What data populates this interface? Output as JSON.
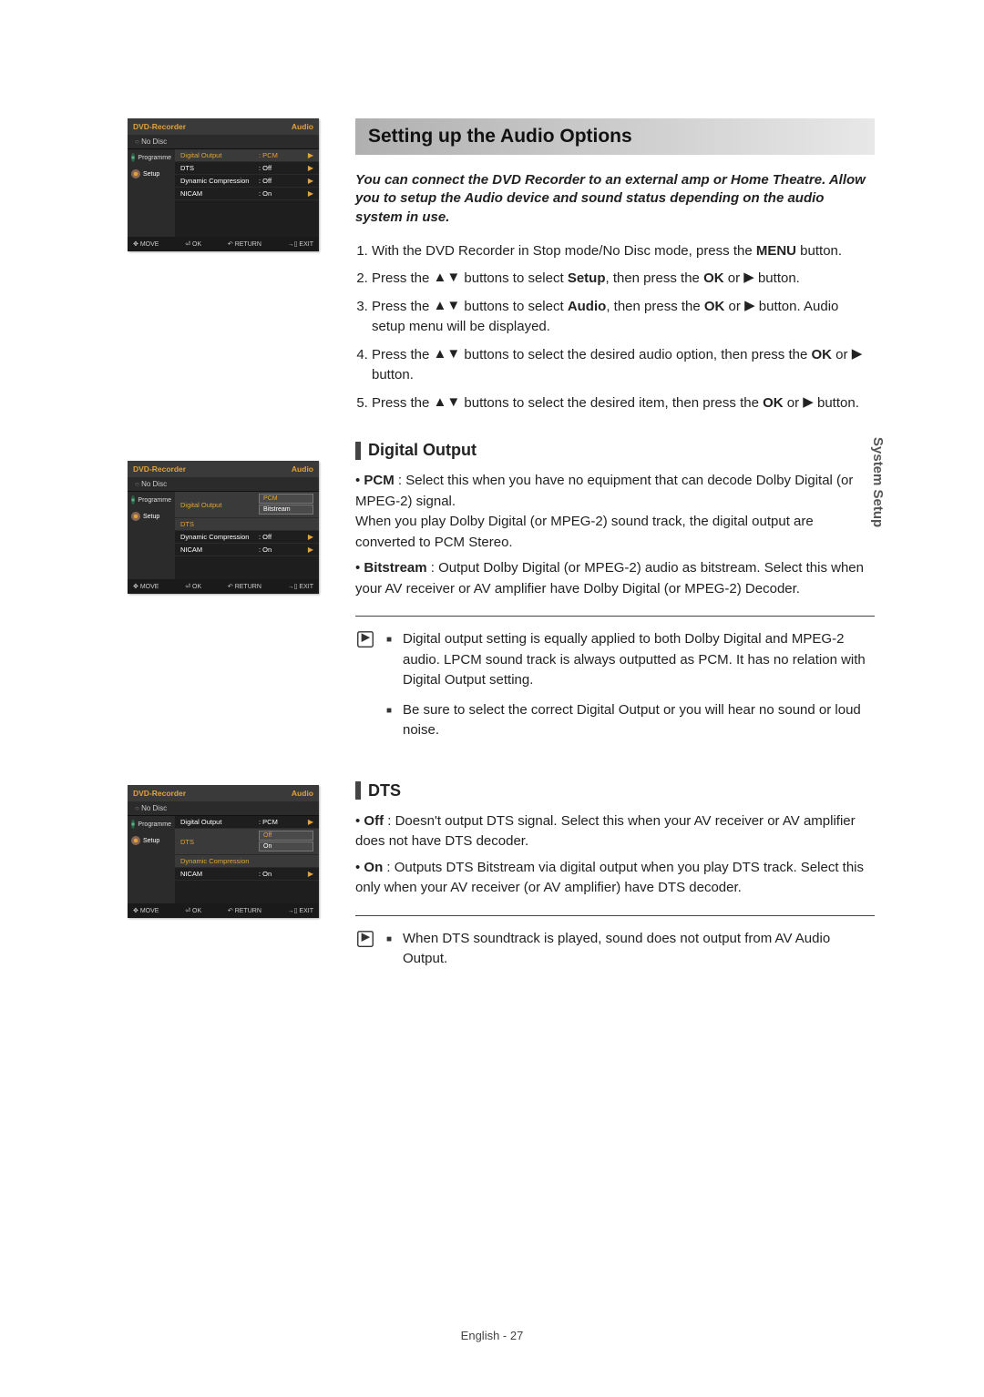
{
  "page": {
    "side_tab": "System Setup",
    "footer": "English - 27"
  },
  "banner": "Setting up the Audio Options",
  "intro": "You can connect the DVD Recorder to an external amp or Home Theatre. Allow you to setup the Audio device and sound status depending on the audio system in use.",
  "steps": {
    "s1": "With the DVD Recorder in Stop mode/No Disc mode, press the MENU button.",
    "s2a": "Press the ",
    "s2b": " buttons to select Setup, then press the OK or ",
    "s2c": " button.",
    "s3a": "Press the ",
    "s3b": " buttons to select Audio, then press the OK or ",
    "s3c": " button. Audio setup menu will be displayed.",
    "s4a": "Press the ",
    "s4b": " buttons to select the desired audio option, then press the OK or ",
    "s4c": " button.",
    "s5a": "Press the ",
    "s5b": " buttons to select the desired item, then press the OK or ",
    "s5c": " button."
  },
  "symbols": {
    "updown": "▲▼",
    "play": "▶"
  },
  "sections": {
    "digital": {
      "title": "Digital Output",
      "pcm_label": "PCM",
      "pcm_text": " : Select this when you have no equipment that can decode Dolby Digital (or MPEG-2) signal.",
      "pcm_text2": "When you play Dolby Digital (or MPEG-2) sound track, the digital output are converted to PCM Stereo.",
      "bit_label": "Bitstream",
      "bit_text": " : Output Dolby Digital (or MPEG-2) audio as bitstream. Select this when your AV receiver or AV amplifier have Dolby Digital (or MPEG-2) Decoder.",
      "note1": "Digital output setting is equally applied to both Dolby Digital and MPEG-2 audio. LPCM sound track is always outputted as PCM. It has no relation with Digital Output setting.",
      "note2": "Be sure to select the correct Digital Output or you will hear no sound or loud noise."
    },
    "dts": {
      "title": "DTS",
      "off_label": "Off",
      "off_text": " : Doesn't output DTS signal. Select this when your AV receiver or AV amplifier does not have DTS decoder.",
      "on_label": "On",
      "on_text": " : Outputs DTS Bitstream via digital output when you play DTS track. Select this only when your AV receiver (or AV amplifier) have DTS decoder.",
      "note1": "When DTS soundtrack is played, sound does not output from AV Audio Output."
    }
  },
  "osd": {
    "title_left": "DVD-Recorder",
    "title_right": "Audio",
    "status": "No Disc",
    "side": {
      "programme": "Programme",
      "setup": "Setup"
    },
    "rows": {
      "digital": {
        "label": "Digital Output",
        "val": ": PCM"
      },
      "dts": {
        "label": "DTS",
        "val": ": Off"
      },
      "dyn": {
        "label": "Dynamic Compression",
        "val": ": Off"
      },
      "nicam": {
        "label": "NICAM",
        "val": ": On"
      }
    },
    "dd_digital": {
      "opt1": "PCM",
      "opt2": "Bitstream"
    },
    "dd_dts": {
      "opt1": "Off",
      "opt2": "On"
    },
    "footer": {
      "move": "MOVE",
      "ok": "OK",
      "return": "RETURN",
      "exit": "EXIT"
    },
    "footer_icons": {
      "move": "✥",
      "ok": "⏎",
      "return": "↶",
      "exit": "→▯"
    }
  }
}
